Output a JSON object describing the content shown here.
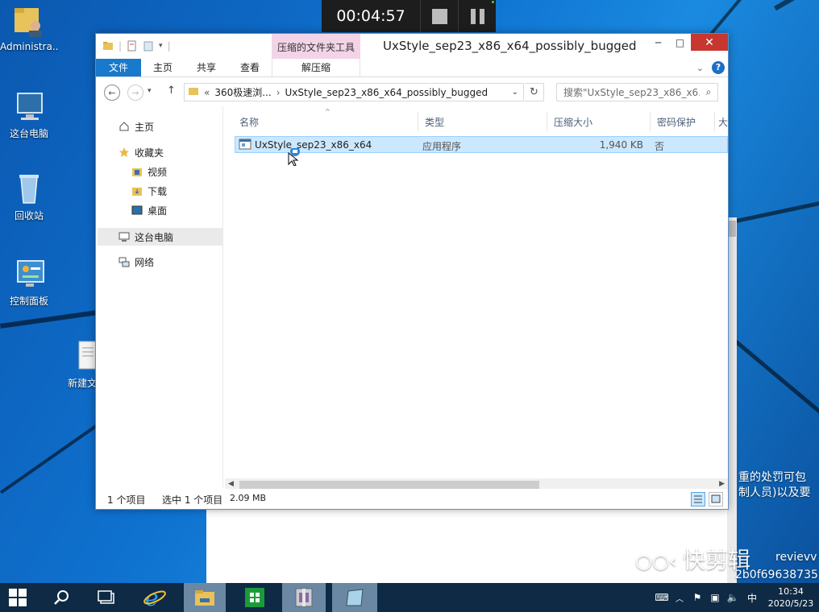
{
  "recorder": {
    "time": "00:04:57"
  },
  "desktop": {
    "icons": [
      {
        "label": "Administra...",
        "icon": "user-folder-icon"
      },
      {
        "label": "这台电脑",
        "icon": "computer-icon"
      },
      {
        "label": "回收站",
        "icon": "recycle-bin-icon"
      },
      {
        "label": "控制面板",
        "icon": "control-panel-icon"
      },
      {
        "label": "新建文本",
        "icon": "text-file-icon"
      }
    ],
    "overlay_lines": [
      "重的处罚可包",
      "制人员)以及要",
      "revievv",
      "2b0f69638735"
    ],
    "watermark": "快剪辑"
  },
  "window": {
    "context_tool_label": "压缩的文件夹工具",
    "title": "UxStyle_sep23_x86_x64_possibly_bugged",
    "minimize": "─",
    "maximize": "□",
    "close": "✕",
    "ribbon_tabs": [
      "文件",
      "主页",
      "共享",
      "查看",
      "解压缩"
    ],
    "help": "?",
    "address": {
      "prefix": "«",
      "segments": [
        "360极速浏...",
        "UxStyle_sep23_x86_x64_possibly_bugged"
      ],
      "separator": "›"
    },
    "search_placeholder": "搜索\"UxStyle_sep23_x86_x6...",
    "nav": {
      "home": "主页",
      "favorites": "收藏夹",
      "videos": "视频",
      "downloads": "下载",
      "desktop": "桌面",
      "this_pc": "这台电脑",
      "network": "网络"
    },
    "columns": [
      "名称",
      "类型",
      "压缩大小",
      "密码保护",
      "大"
    ],
    "files": [
      {
        "name": "UxStyle_sep23_x86_x64",
        "type": "应用程序",
        "size": "1,940 KB",
        "password": "否"
      }
    ],
    "status": {
      "count": "1 个项目",
      "selected": "选中 1 个项目",
      "size": "2.09 MB"
    }
  },
  "taskbar": {
    "ime": "中",
    "time": "10:34",
    "date": "2020/5/23"
  },
  "colors": {
    "accent": "#1979ca",
    "close": "#c7362f",
    "context_tab": "#f3d4e7",
    "selection": "#cce8ff"
  }
}
